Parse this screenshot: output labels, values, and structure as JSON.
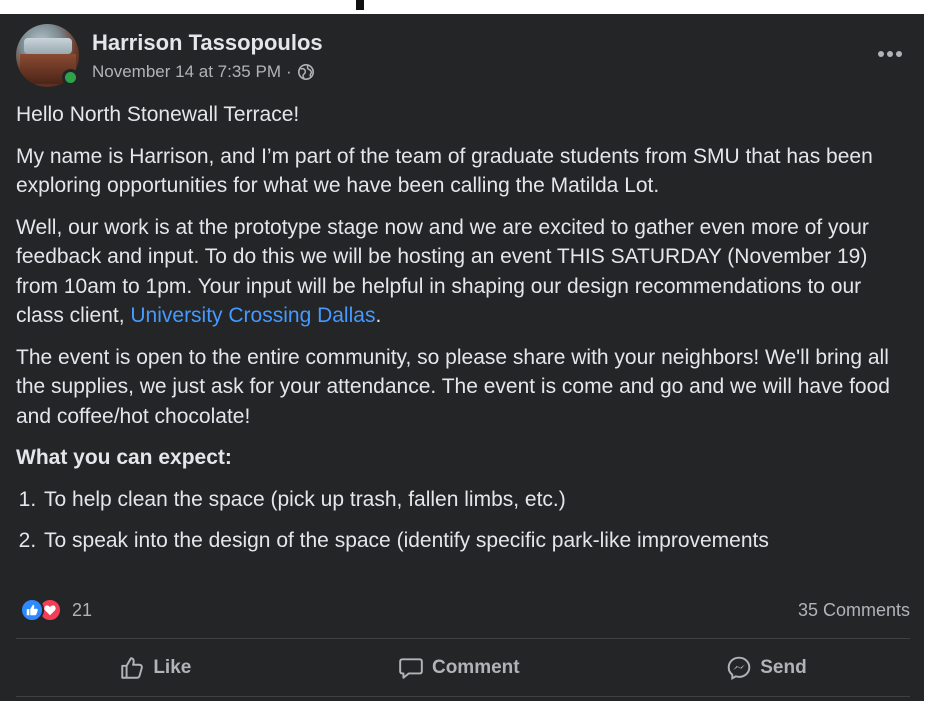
{
  "post": {
    "author": "Harrison Tassopoulos",
    "timestamp": "November 14 at 7:35 PM",
    "separator": "·",
    "audience_icon": "globe-icon",
    "paragraphs": {
      "greeting": "Hello North Stonewall Terrace!",
      "intro": "My name is Harrison, and I’m part of the team of graduate students from SMU that has been exploring opportunities for what we have been calling the Matilda Lot.",
      "event_before_link": "Well, our work is at the prototype stage now and we are excited to gather even more of your feedback and input. To do this we will be hosting an event THIS SATURDAY (November 19) from 10am to 1pm. Your input will be helpful in shaping our design recommendations to our class client, ",
      "event_link": "University Crossing Dallas",
      "event_after_link": ".",
      "community": "The event is open to the entire community, so please share with your neighbors! We'll bring all the supplies, we just ask for your attendance. The event is come and go and we will have food and coffee/hot chocolate!"
    },
    "expect_heading": "What you can expect:",
    "expect_items": [
      "To help clean the space (pick up trash, fallen limbs, etc.)",
      "To speak into the design of the space (identify specific park-like improvements"
    ]
  },
  "stats": {
    "reaction_count": "21",
    "comments": "35 Comments"
  },
  "actions": {
    "like": "Like",
    "comment": "Comment",
    "send": "Send"
  },
  "colors": {
    "background": "#242526",
    "text": "#e4e6eb",
    "secondary_text": "#b0b3b8",
    "link": "#4599ff",
    "like_blue": "#2e89ff",
    "love_red": "#f33e58",
    "online_green": "#31a24c"
  }
}
